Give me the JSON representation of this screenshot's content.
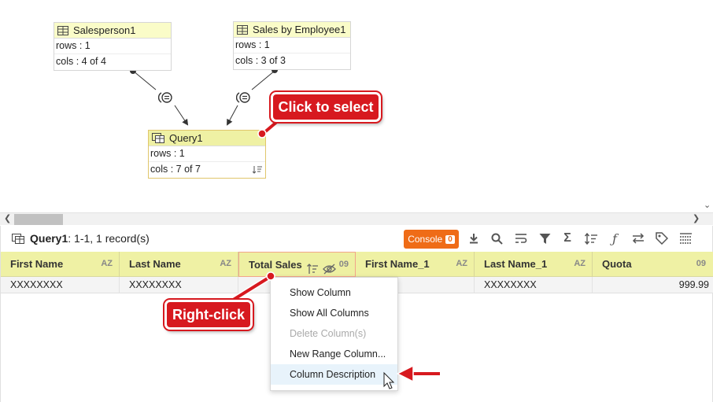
{
  "nodes": {
    "salesperson": {
      "title": "Salesperson1",
      "rows": "rows : 1",
      "cols": "cols : 4 of 4"
    },
    "sales_by_employee": {
      "title": "Sales by Employee1",
      "rows": "rows : 1",
      "cols": "cols : 3 of 3"
    },
    "query": {
      "title": "Query1",
      "rows": "rows : 1",
      "cols": "cols : 7 of 7"
    }
  },
  "icons": {
    "table": "table-icon",
    "query": "query-table-icon",
    "join": "join-icon",
    "sort": "sort-icon"
  },
  "results": {
    "query_name": "Query1",
    "summary": ": 1-1, 1 record(s)",
    "console_label": "Console",
    "console_count": "0",
    "toolbar_icons": [
      "download-icon",
      "search-icon",
      "wrap-icon",
      "filter-icon",
      "sigma-icon",
      "sort-icon",
      "function-icon",
      "swap-icon",
      "tag-icon",
      "columns-icon"
    ]
  },
  "grid": {
    "columns": [
      {
        "label": "First Name",
        "type": "AZ"
      },
      {
        "label": "Last Name",
        "type": "AZ"
      },
      {
        "label": "Total Sales",
        "type": "09"
      },
      {
        "label": "First Name_1",
        "type": "AZ"
      },
      {
        "label": "Last Name_1",
        "type": "AZ"
      },
      {
        "label": "Quota",
        "type": "09"
      }
    ],
    "row": [
      "XXXXXXXX",
      "XXXXXXXX",
      "",
      "XXX",
      "XXXXXXXX",
      "999.99"
    ]
  },
  "context_menu": {
    "items": [
      {
        "label": "Show Column",
        "enabled": true
      },
      {
        "label": "Show All Columns",
        "enabled": true
      },
      {
        "label": "Delete Column(s)",
        "enabled": false
      },
      {
        "label": "New Range Column...",
        "enabled": true
      },
      {
        "label": "Column Description",
        "enabled": true
      }
    ]
  },
  "callouts": {
    "select": "Click to select",
    "right_click": "Right-click"
  },
  "colors": {
    "header_yellow": "#eff1a4",
    "console_orange": "#ef6c17",
    "callout_red": "#d7191f"
  }
}
